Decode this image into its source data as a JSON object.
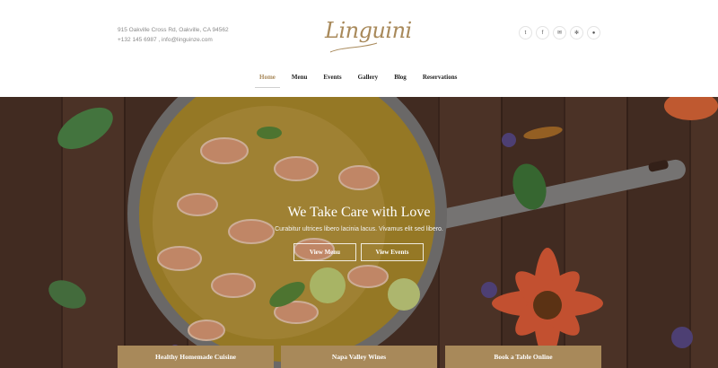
{
  "header": {
    "address_line": "915 Oakville Cross Rd, Oakville, CA 94562",
    "contact_line": "+132 145 6987 , info@linguinze.com",
    "logo_text": "Linguini",
    "social": [
      {
        "icon": "twitter-icon",
        "glyph": "t"
      },
      {
        "icon": "facebook-icon",
        "glyph": "f"
      },
      {
        "icon": "email-icon",
        "glyph": "✉"
      },
      {
        "icon": "yelp-icon",
        "glyph": "✻"
      },
      {
        "icon": "tripadvisor-icon",
        "glyph": "●"
      }
    ]
  },
  "nav": {
    "items": [
      "Home",
      "Menu",
      "Events",
      "Gallery",
      "Blog",
      "Reservations"
    ],
    "active": "Home"
  },
  "hero": {
    "title": "We Take Care with Love",
    "subtitle": "Curabitur ultrices libero lacinia lacus. Vivamus elit sed libero.",
    "button_menu": "View Menu",
    "button_events": "View Events"
  },
  "cards": {
    "items": [
      "Healthy Homemade Cuisine",
      "Napa Valley Wines",
      "Book a Table Online"
    ]
  },
  "colors": {
    "accent": "#a8895a",
    "wood": "#4b3228"
  }
}
